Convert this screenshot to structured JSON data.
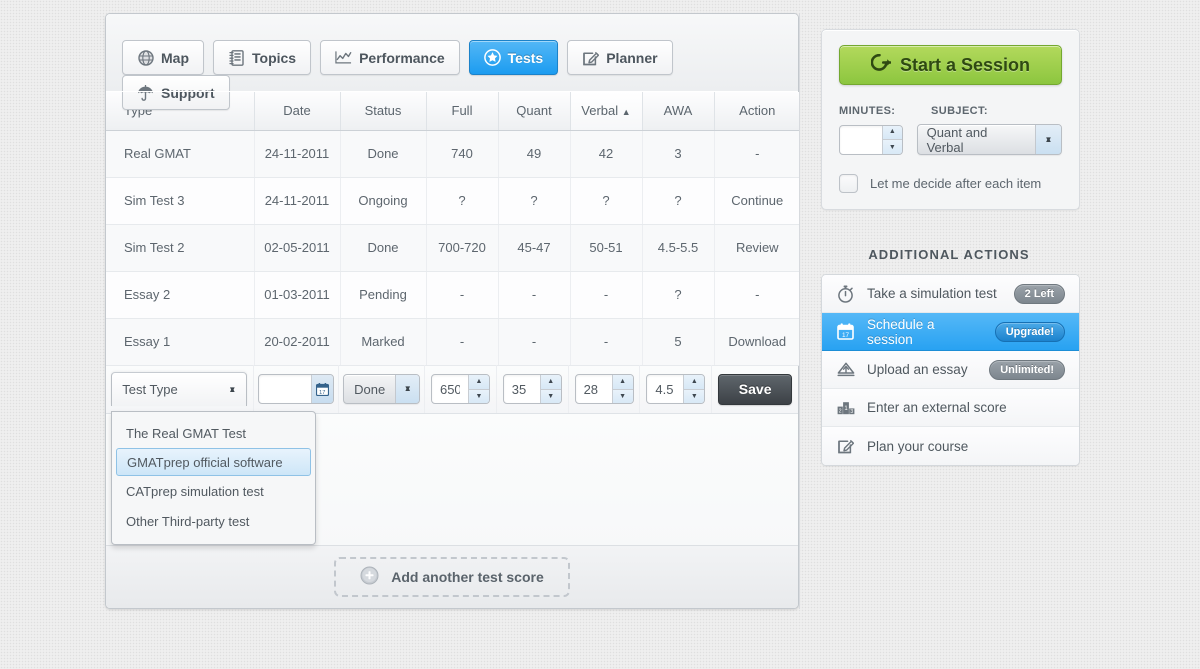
{
  "nav": {
    "items": [
      {
        "label": "Map",
        "icon": "globe-icon",
        "active": false
      },
      {
        "label": "Topics",
        "icon": "notebook-icon",
        "active": false
      },
      {
        "label": "Performance",
        "icon": "line-chart-icon",
        "active": false
      },
      {
        "label": "Tests",
        "icon": "target-star-icon",
        "active": true
      },
      {
        "label": "Planner",
        "icon": "pencil-square-icon",
        "active": false
      },
      {
        "label": "Support",
        "icon": "umbrella-icon",
        "active": false
      }
    ]
  },
  "table": {
    "columns": [
      {
        "label": "Type",
        "sorted": false
      },
      {
        "label": "Date",
        "sorted": false
      },
      {
        "label": "Status",
        "sorted": false
      },
      {
        "label": "Full",
        "sorted": false
      },
      {
        "label": "Quant",
        "sorted": false
      },
      {
        "label": "Verbal",
        "sorted": true,
        "sort_indicator": "▲"
      },
      {
        "label": "AWA",
        "sorted": false
      },
      {
        "label": "Action",
        "sorted": false
      }
    ],
    "rows": [
      {
        "type": "Real GMAT",
        "date": "24-11-2011",
        "status": "Done",
        "full": "740",
        "quant": "49",
        "verbal": "42",
        "awa": "3",
        "action": "-"
      },
      {
        "type": "Sim Test 3",
        "date": "24-11-2011",
        "status": "Ongoing",
        "full": "?",
        "quant": "?",
        "verbal": "?",
        "awa": "?",
        "action": "Continue"
      },
      {
        "type": "Sim Test 2",
        "date": "02-05-2011",
        "status": "Done",
        "full": "700-720",
        "quant": "45-47",
        "verbal": "50-51",
        "awa": "4.5-5.5",
        "action": "Review"
      },
      {
        "type": "Essay 2",
        "date": "01-03-2011",
        "status": "Pending",
        "full": "-",
        "quant": "-",
        "verbal": "-",
        "awa": "?",
        "action": "-"
      },
      {
        "type": "Essay 1",
        "date": "20-02-2011",
        "status": "Marked",
        "full": "-",
        "quant": "-",
        "verbal": "-",
        "awa": "5",
        "action": "Download"
      }
    ]
  },
  "edit_row": {
    "type_select": {
      "label": "Test Type",
      "options": [
        "The Real GMAT Test",
        "GMATprep official software",
        "CATprep simulation test",
        "Other Third-party test"
      ],
      "selected_option": "GMATprep official software",
      "open": true
    },
    "date_value": "",
    "date_placeholder": "",
    "status_value": "Done",
    "full_value": "650",
    "quant_value": "35",
    "verbal_value": "28",
    "awa_value": "4.5",
    "save_label": "Save"
  },
  "footer": {
    "add_label": "Add another test score",
    "add_icon": "plus-circle-icon"
  },
  "session": {
    "start_label": "Start a Session",
    "start_icon": "arrow-out-icon",
    "minutes_label": "MINUTES:",
    "minutes_value": "",
    "subject_label": "SUBJECT:",
    "subject_value": "Quant and Verbal",
    "checkbox_label": "Let me decide after each item",
    "checkbox_checked": false
  },
  "additional_actions": {
    "title": "ADDITIONAL ACTIONS",
    "items": [
      {
        "label": "Take a simulation test",
        "icon": "stopwatch-icon",
        "badge": "2 Left",
        "badge_style": "grey",
        "highlighted": false
      },
      {
        "label": "Schedule a session",
        "icon": "calendar-icon",
        "badge": "Upgrade!",
        "badge_style": "blue",
        "highlighted": true
      },
      {
        "label": "Upload an essay",
        "icon": "upload-icon",
        "badge": "Unlimited!",
        "badge_style": "grey",
        "highlighted": false
      },
      {
        "label": "Enter an external score",
        "icon": "podium-icon",
        "badge": "",
        "badge_style": "",
        "highlighted": false
      },
      {
        "label": "Plan your course",
        "icon": "pencil-square-icon",
        "badge": "",
        "badge_style": "",
        "highlighted": false
      }
    ]
  },
  "colors": {
    "accent_blue": "#28a2f2",
    "accent_green": "#8cc63f",
    "page_bg": "#ececec",
    "text": "#50585f"
  }
}
